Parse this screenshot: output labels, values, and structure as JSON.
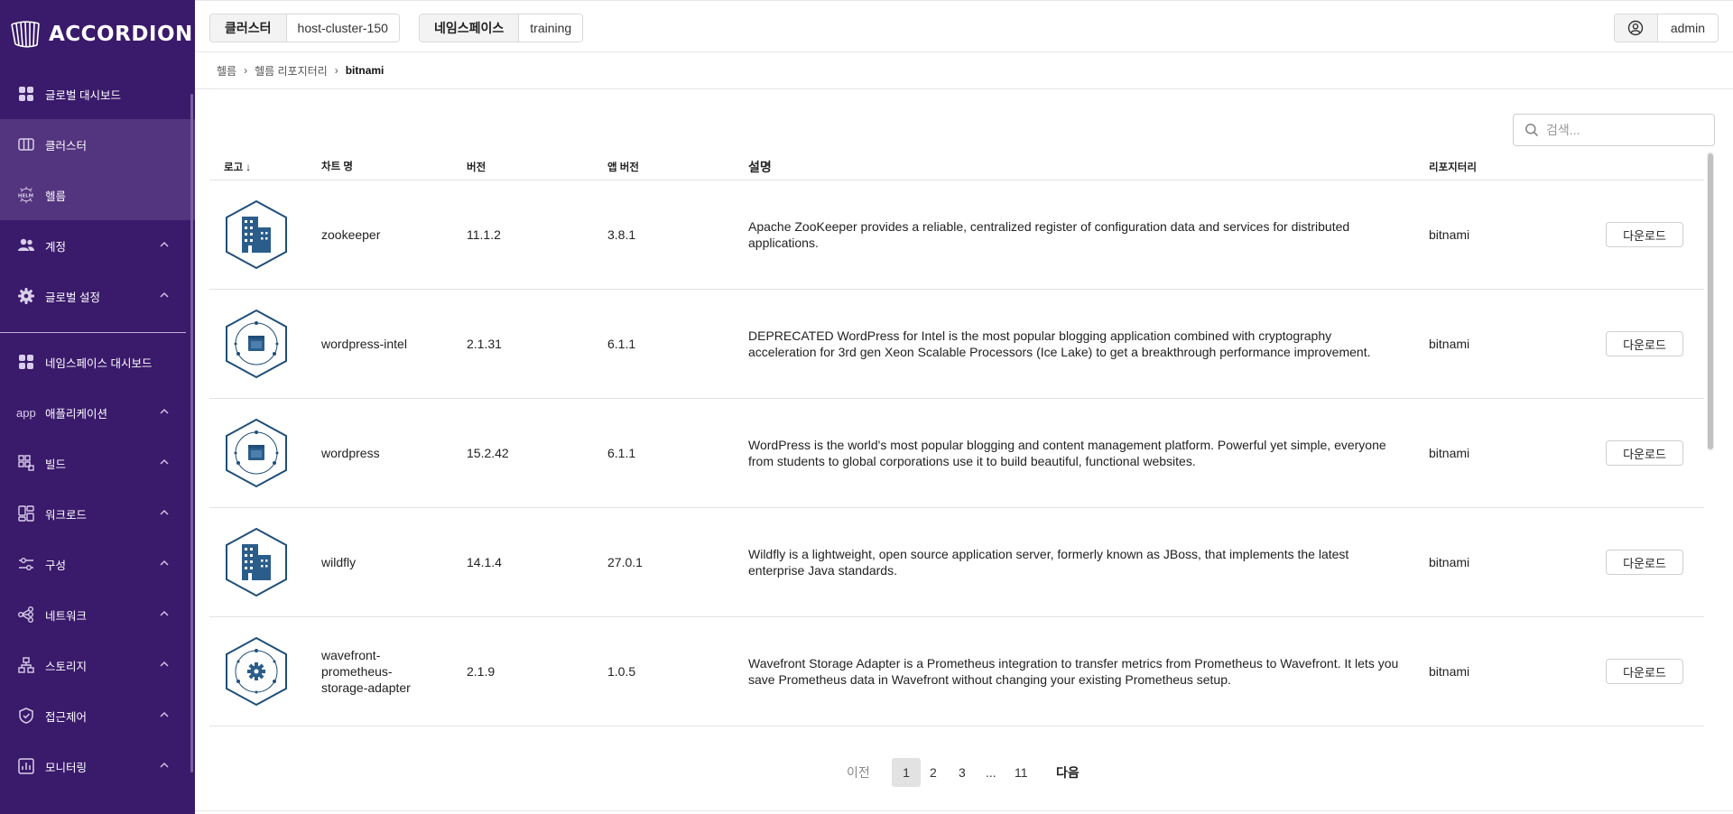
{
  "brand": {
    "name": "ACCORDION"
  },
  "colors": {
    "sidebar_bg": "#3a1a6b",
    "sidebar_active": "#53347e",
    "hex_stroke": "#1f4e79",
    "hex_fill": "#2b5d8a"
  },
  "sidebar": {
    "items": [
      {
        "label": "글로벌 대시보드",
        "icon": "dashboard-icon"
      },
      {
        "label": "클러스터",
        "icon": "cluster-icon"
      },
      {
        "label": "헬름",
        "icon": "helm-icon"
      },
      {
        "label": "계정",
        "icon": "users-icon"
      },
      {
        "label": "글로벌 설정",
        "icon": "gear-icon"
      }
    ],
    "ns_items": [
      {
        "label": "네임스페이스 대시보드",
        "icon": "dashboard-icon"
      },
      {
        "label": "애플리케이션",
        "icon_text": "app"
      },
      {
        "label": "빌드",
        "icon": "build-icon"
      },
      {
        "label": "워크로드",
        "icon": "workload-icon"
      },
      {
        "label": "구성",
        "icon": "sliders-icon"
      },
      {
        "label": "네트워크",
        "icon": "network-icon"
      },
      {
        "label": "스토리지",
        "icon": "storage-icon"
      },
      {
        "label": "접근제어",
        "icon": "shield-icon"
      },
      {
        "label": "모니터링",
        "icon": "chart-icon"
      }
    ]
  },
  "header": {
    "cluster_label": "클러스터",
    "cluster_value": "host-cluster-150",
    "namespace_label": "네임스페이스",
    "namespace_value": "training",
    "user": "admin"
  },
  "breadcrumb": [
    "헬름",
    "헬름 리포지터리",
    "bitnami"
  ],
  "search": {
    "placeholder": "검색..."
  },
  "table": {
    "headers": {
      "logo": "로고",
      "name": "차트 명",
      "version": "버전",
      "app_version": "앱 버전",
      "description": "설명",
      "repository": "리포지터리"
    },
    "rows": [
      {
        "name": "zookeeper",
        "version": "11.1.2",
        "app_version": "3.8.1",
        "description": "Apache ZooKeeper provides a reliable, centralized register of configuration data and services for distributed applications.",
        "repository": "bitnami",
        "action": "다운로드",
        "logo": "building-icon"
      },
      {
        "name": "wordpress-intel",
        "version": "2.1.31",
        "app_version": "6.1.1",
        "description": "DEPRECATED WordPress for Intel is the most popular blogging application combined with cryptography acceleration for 3rd gen Xeon Scalable Processors (Ice Lake) to get a breakthrough performance improvement.",
        "repository": "bitnami",
        "action": "다운로드",
        "logo": "window-orbit-icon"
      },
      {
        "name": "wordpress",
        "version": "15.2.42",
        "app_version": "6.1.1",
        "description": "WordPress is the world's most popular blogging and content management platform. Powerful yet simple, everyone from students to global corporations use it to build beautiful, functional websites.",
        "repository": "bitnami",
        "action": "다운로드",
        "logo": "window-orbit-icon"
      },
      {
        "name": "wildfly",
        "version": "14.1.4",
        "app_version": "27.0.1",
        "description": "Wildfly is a lightweight, open source application server, formerly known as JBoss, that implements the latest enterprise Java standards.",
        "repository": "bitnami",
        "action": "다운로드",
        "logo": "building-icon"
      },
      {
        "name": "wavefront-prometheus-storage-adapter",
        "name_lines": [
          "wavefront-",
          "prometheus-",
          "storage-adapter"
        ],
        "version": "2.1.9",
        "app_version": "1.0.5",
        "description": "Wavefront Storage Adapter is a Prometheus integration to transfer metrics from Prometheus to Wavefront. It lets you save Prometheus data in Wavefront without changing your existing Prometheus setup.",
        "repository": "bitnami",
        "action": "다운로드",
        "logo": "gear-orbit-icon"
      }
    ]
  },
  "pagination": {
    "prev": "이전",
    "pages": [
      "1",
      "2",
      "3",
      "...",
      "11"
    ],
    "current": "1",
    "next": "다음"
  }
}
